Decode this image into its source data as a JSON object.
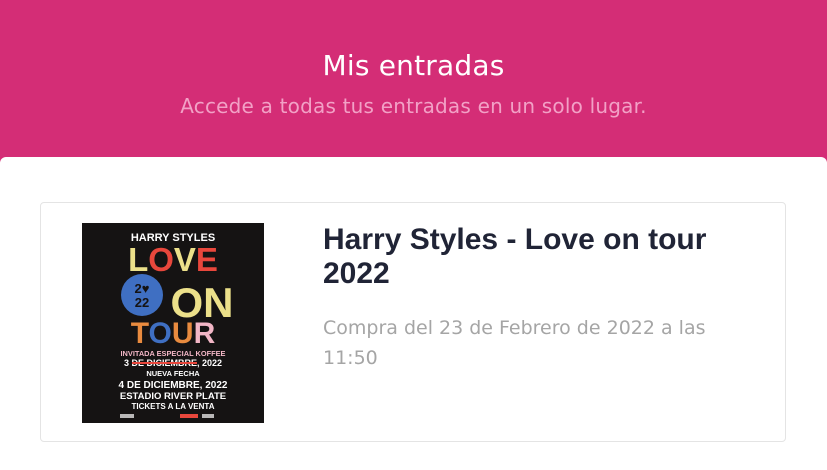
{
  "header": {
    "title": "Mis entradas",
    "subtitle": "Accede a todas tus entradas en un solo lugar."
  },
  "tickets": [
    {
      "event_title": "Harry Styles - Love on tour 2022",
      "purchase_text": "Compra del 23 de Febrero de 2022 a las 11:50",
      "poster": {
        "artist": "HARRY STYLES",
        "word_love": "LOVE",
        "badge_line1": "2",
        "badge_line2": "22",
        "word_on": "ON",
        "word_tour": "TOUR",
        "guest_line": "INVITADA ESPECIAL KOFFEE",
        "date_old": "3 DE DICIEMBRE, 2022",
        "new_date_label": "NUEVA FECHA",
        "date_new": "4 DE DICIEMBRE, 2022",
        "venue": "ESTADIO RIVER PLATE",
        "tickets_line": "TICKETS A LA VENTA"
      }
    }
  ],
  "colors": {
    "header_bg": "#d42d76",
    "title_text": "#ffffff",
    "subtitle_text": "#f2a1c6",
    "event_title_text": "#202436",
    "purchase_text": "#a5a5a5",
    "poster_bg": "#151313",
    "poster_red": "#e8473c",
    "poster_yellow": "#ece08a",
    "poster_pink": "#f2b6c6",
    "poster_blue": "#3f6fc2",
    "poster_orange": "#e98b3f"
  }
}
